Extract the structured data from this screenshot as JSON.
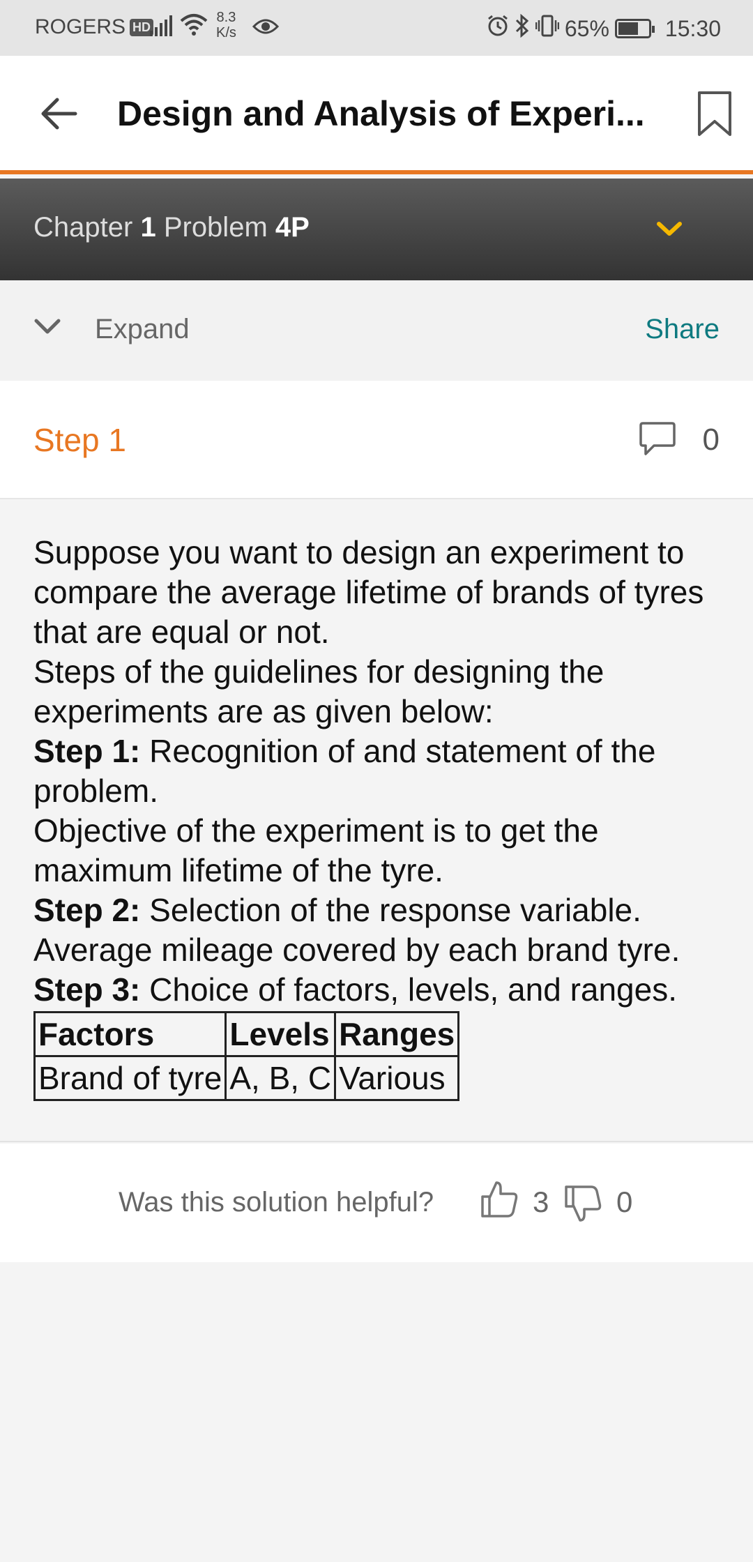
{
  "status_bar": {
    "carrier": "ROGERS",
    "carrier_badge": "HD",
    "speed_value": "8.3",
    "speed_unit": "K/s",
    "battery": "65%",
    "time": "15:30"
  },
  "app_bar": {
    "title": "Design and Analysis of Experi..."
  },
  "chapter_bar": {
    "chapter_label": "Chapter",
    "chapter_number": "1",
    "problem_label": "Problem",
    "problem_number": "4P"
  },
  "expand_bar": {
    "expand_label": "Expand",
    "share_label": "Share"
  },
  "step": {
    "label": "Step 1",
    "comment_count": "0"
  },
  "content": {
    "intro": "Suppose you want to design an experiment to compare the average lifetime of brands of tyres that are equal or not.",
    "guidelines_intro": "Steps of the guidelines for designing the experiments are as given below:",
    "step1_label": "Step 1:",
    "step1_text": " Recognition of and statement of the problem.",
    "objective": "Objective of the experiment is to get the maximum lifetime of the tyre.",
    "step2_label": "Step 2:",
    "step2_text": " Selection of the response variable.",
    "response": "Average mileage covered by each brand tyre.",
    "step3_label": "Step 3:",
    "step3_text": " Choice of factors, levels, and ranges.",
    "table": {
      "headers": [
        "Factors",
        "Levels",
        "Ranges"
      ],
      "rows": [
        [
          "Brand of tyre",
          "A, B, C",
          "Various"
        ]
      ]
    }
  },
  "feedback": {
    "question": "Was this solution helpful?",
    "thumbs_up_count": "3",
    "thumbs_down_count": "0"
  },
  "colors": {
    "accent_orange": "#e87722",
    "share_teal": "#0e7a80",
    "dropdown_yellow": "#f5b800"
  }
}
